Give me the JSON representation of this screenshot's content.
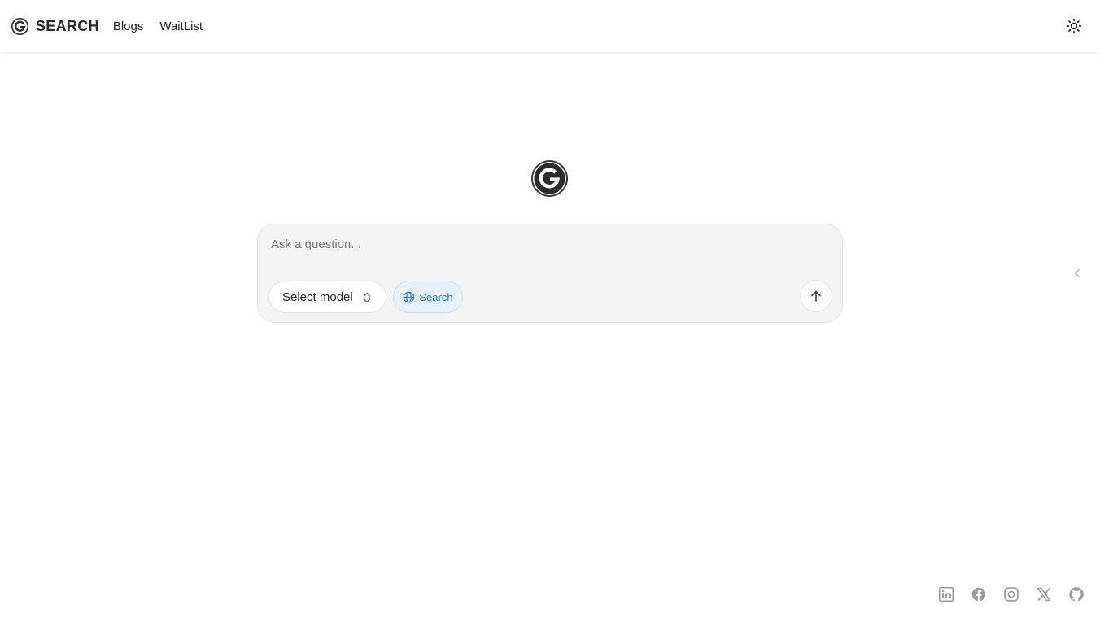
{
  "header": {
    "brand_text": "SEARCH",
    "nav": [
      {
        "label": "Blogs"
      },
      {
        "label": "WaitList"
      }
    ],
    "theme_toggle_icon": "sun-icon"
  },
  "center_logo_icon": "g-logo-icon",
  "composer": {
    "placeholder": "Ask a question...",
    "value": "",
    "model_select_label": "Select model",
    "search_chip_label": "Search",
    "send_icon": "arrow-up-icon"
  },
  "side_handle_icon": "chevron-left-icon",
  "footer": {
    "social_icons": [
      "linkedin-icon",
      "facebook-icon",
      "instagram-icon",
      "x-icon",
      "github-icon"
    ]
  },
  "colors": {
    "accent": "#1a73c9",
    "chip_bg": "#e6f1fc",
    "composer_bg": "#f4f4f4",
    "icon_gray": "#9a9a9a"
  }
}
